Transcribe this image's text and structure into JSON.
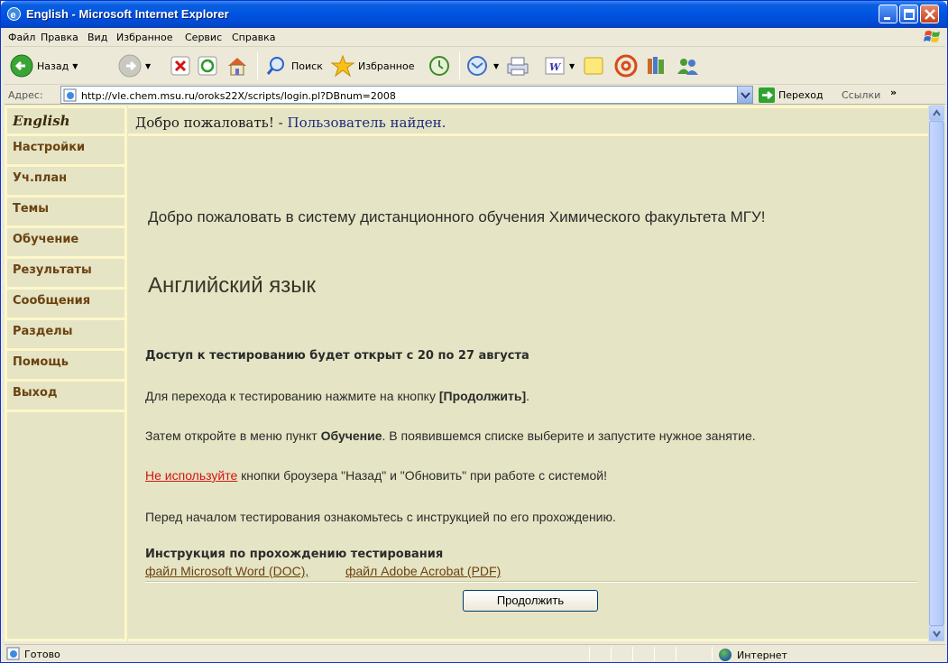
{
  "window": {
    "title": "English - Microsoft Internet Explorer"
  },
  "menu": {
    "items": [
      "Файл",
      "Правка",
      "Вид",
      "Избранное",
      "Сервис",
      "Справка"
    ]
  },
  "toolbar": {
    "back_label": "Назад",
    "search_label": "Поиск",
    "favorites_label": "Избранное"
  },
  "address": {
    "label": "Адрес:",
    "url": "http://vle.chem.msu.ru/oroks22X/scripts/login.pl?DBnum=2008",
    "go_label": "Переход",
    "links_label": "Ссылки"
  },
  "nav": {
    "title": "English",
    "items": [
      "Настройки",
      "Уч.план",
      "Темы",
      "Обучение",
      "Результаты",
      "Сообщения",
      "Разделы",
      "Помощь",
      "Выход"
    ]
  },
  "header": {
    "greeting": "Добро пожаловать! - ",
    "status": "Пользователь найден."
  },
  "content": {
    "welcome": "Добро пожаловать в систему дистанционного обучения Химического факультета МГУ!",
    "course": "Английский язык",
    "access": "Доступ к тестированию будет открыт с 20 по 27 августа",
    "p1_prefix": "Для перехода к тестированию нажмите на кнопку ",
    "p1_bold": "[Продолжить]",
    "p1_suffix": ".",
    "p2_prefix": "Затем откройте в меню пункт ",
    "p2_bold": "Обучение",
    "p2_suffix": ". В появившемся списке выберите и запустите нужное занятие.",
    "p3_link": "Не используйте",
    "p3_suffix": " кнопки броузера \"Назад\" и \"Обновить\" при работе с системой!",
    "p4": "Перед началом тестирования ознакомьтесь с инструкцией по его прохождению.",
    "instr_title": "Инструкция по прохождению тестирования",
    "doc_link": "файл Microsoft Word (DOC),",
    "pdf_link": "файл Adobe Acrobat (PDF)",
    "continue_label": "Продолжить"
  },
  "statusbar": {
    "text": "Готово",
    "zone": "Интернет"
  }
}
